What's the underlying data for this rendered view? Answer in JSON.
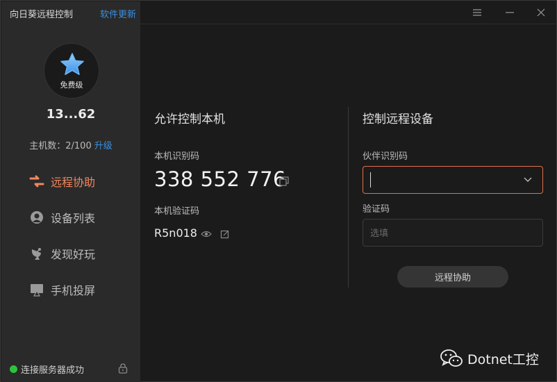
{
  "sidebar": {
    "app_title": "向日葵远程控制",
    "update_link": "软件更新",
    "avatar_tier": "免费级",
    "account": "13...62",
    "hosts_label": "主机数：2/100",
    "upgrade_link": "升级",
    "nav": [
      {
        "label": "远程协助",
        "icon": "remote-assist-icon",
        "active": true
      },
      {
        "label": "设备列表",
        "icon": "device-list-icon",
        "active": false
      },
      {
        "label": "发现好玩",
        "icon": "discover-icon",
        "active": false
      },
      {
        "label": "手机投屏",
        "icon": "screen-cast-icon",
        "active": false
      }
    ],
    "status": "连接服务器成功"
  },
  "window_controls": [
    "menu-icon",
    "minimize-icon",
    "close-icon"
  ],
  "local": {
    "title": "允许控制本机",
    "id_label": "本机识别码",
    "id_value": "338 552 776",
    "code_label": "本机验证码",
    "code_value": "R5n018"
  },
  "remote": {
    "title": "控制远程设备",
    "partner_label": "伙伴识别码",
    "partner_value": "",
    "verify_label": "验证码",
    "verify_placeholder": "选填",
    "connect_button": "远程协助"
  },
  "watermark": "Dotnet工控",
  "colors": {
    "accent": "#f0875f",
    "link": "#3a8fe0",
    "online": "#2ec23c",
    "sidebar_bg": "#2a2a2a",
    "main_bg": "#1b1b1b"
  }
}
